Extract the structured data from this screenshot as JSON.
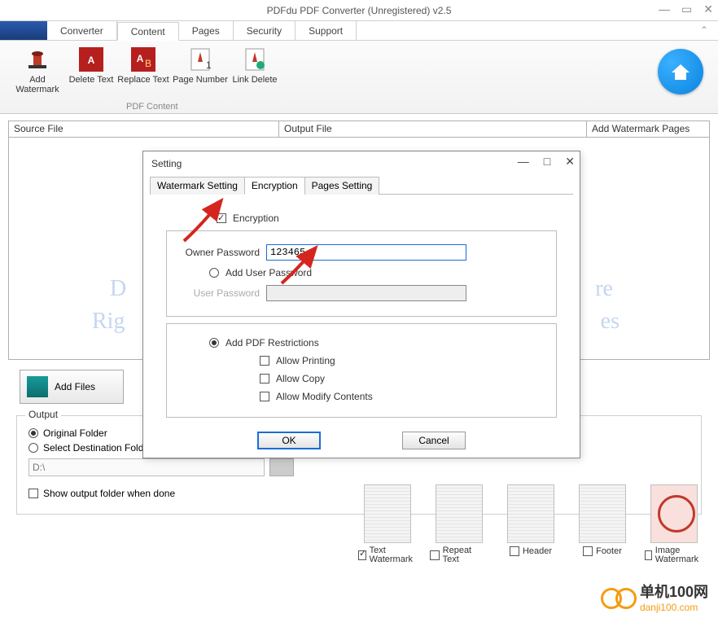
{
  "window": {
    "title": "PDFdu PDF Converter (Unregistered) v2.5"
  },
  "mainTabs": {
    "converter": "Converter",
    "content": "Content",
    "pages": "Pages",
    "security": "Security",
    "support": "Support"
  },
  "ribbon": {
    "addWatermark": "Add Watermark",
    "deleteText": "Delete Text",
    "replaceText": "Replace Text",
    "pageNumber": "Page Number",
    "linkDelete": "Link Delete",
    "group": "PDF Content"
  },
  "grid": {
    "col1": "Source File",
    "col2": "Output File",
    "col3": "Add Watermark Pages"
  },
  "ghost": {
    "l1": "D",
    "l2": "Rig",
    "r1": "re",
    "r2": "es"
  },
  "addFiles": "Add Files",
  "output": {
    "legend": "Output",
    "original": "Original Folder",
    "dest": "Select Destination Folder",
    "path": "D:\\",
    "showDone": "Show output folder when done"
  },
  "thumbs": {
    "text": "Text Watermark",
    "repeat": "Repeat Text",
    "header": "Header",
    "footer": "Footer",
    "image": "Image Watermark"
  },
  "dialog": {
    "title": "Setting",
    "tabs": {
      "wm": "Watermark Setting",
      "enc": "Encryption",
      "pg": "Pages Setting"
    },
    "encryption": "Encryption",
    "ownerPw": "Owner Password",
    "ownerPwVal": "123465",
    "addUserPw": "Add User Password",
    "userPw": "User Password",
    "addRestr": "Add PDF Restrictions",
    "allowPrint": "Allow Printing",
    "allowCopy": "Allow Copy",
    "allowModify": "Allow Modify Contents",
    "ok": "OK",
    "cancel": "Cancel"
  },
  "brand": {
    "name": "单机100网",
    "url": "danji100.com"
  }
}
